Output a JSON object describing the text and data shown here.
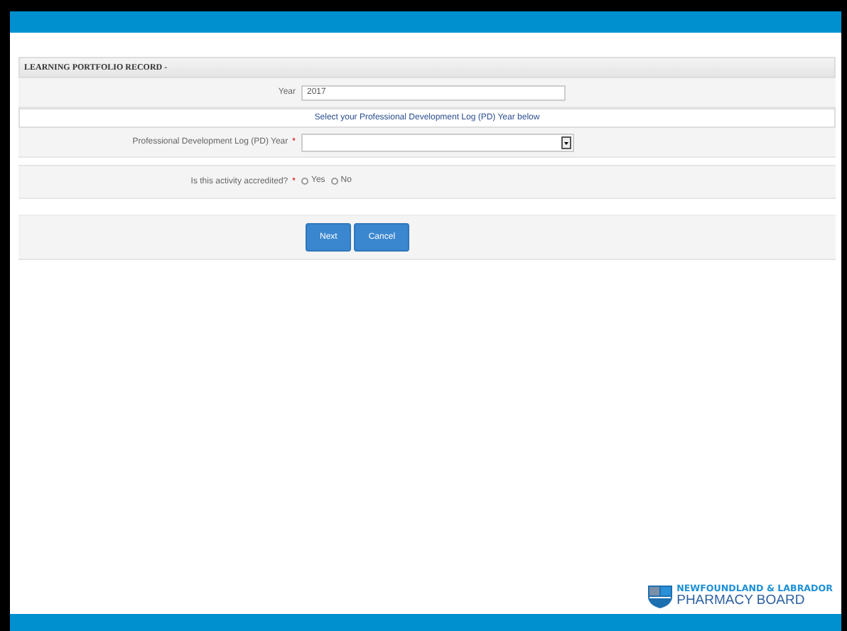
{
  "section": {
    "title": "LEARNING PORTFOLIO RECORD -"
  },
  "year_field": {
    "label": "Year",
    "value": "2017"
  },
  "info_note": "Select your Professional Development Log (PD) Year below",
  "pd_year_field": {
    "label": "Professional Development Log (PD) Year",
    "required_mark": "*"
  },
  "accredited": {
    "label": "Is this activity accredited?",
    "required_mark": "*",
    "options": [
      {
        "label": "Yes",
        "selected": false
      },
      {
        "label": "No",
        "selected": false
      }
    ]
  },
  "buttons": [
    "Next",
    "Cancel"
  ],
  "logo": {
    "line_1": "NEWFOUNDLAND & LABRADOR",
    "line_2": "PHARMACY BOARD"
  }
}
